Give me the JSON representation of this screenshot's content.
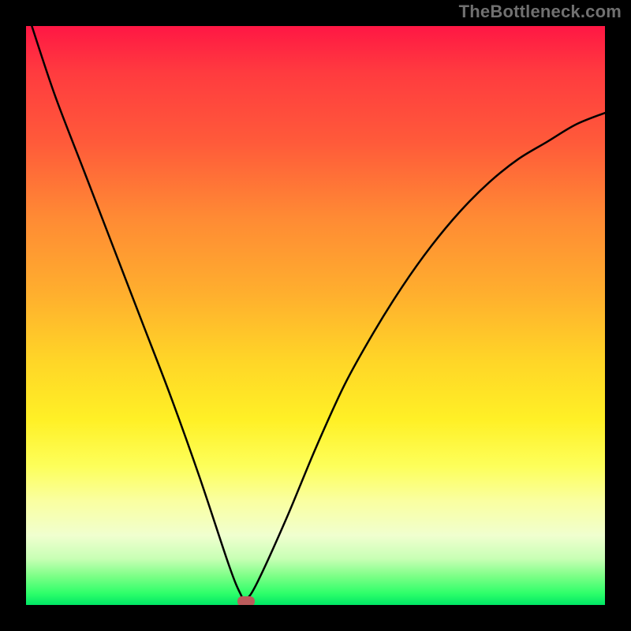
{
  "watermark": "TheBottleneck.com",
  "chart_data": {
    "type": "line",
    "title": "",
    "xlabel": "",
    "ylabel": "",
    "xlim": [
      0,
      100
    ],
    "ylim": [
      0,
      100
    ],
    "grid": false,
    "legend": false,
    "series": [
      {
        "name": "curve",
        "x": [
          1,
          5,
          10,
          15,
          20,
          25,
          30,
          35,
          37,
          38,
          40,
          45,
          50,
          55,
          60,
          65,
          70,
          75,
          80,
          85,
          90,
          95,
          100
        ],
        "y": [
          100,
          88,
          75,
          62,
          49,
          36,
          22,
          7,
          2,
          1,
          4,
          15,
          27,
          38,
          47,
          55,
          62,
          68,
          73,
          77,
          80,
          83,
          85
        ]
      }
    ],
    "marker": {
      "x": 38,
      "y": 0.5
    },
    "gradient_stops": [
      {
        "pos": 0,
        "color": "#ff1744"
      },
      {
        "pos": 33,
        "color": "#ff8a34"
      },
      {
        "pos": 58,
        "color": "#ffd627"
      },
      {
        "pos": 82,
        "color": "#faffa0"
      },
      {
        "pos": 100,
        "color": "#00e765"
      }
    ]
  }
}
